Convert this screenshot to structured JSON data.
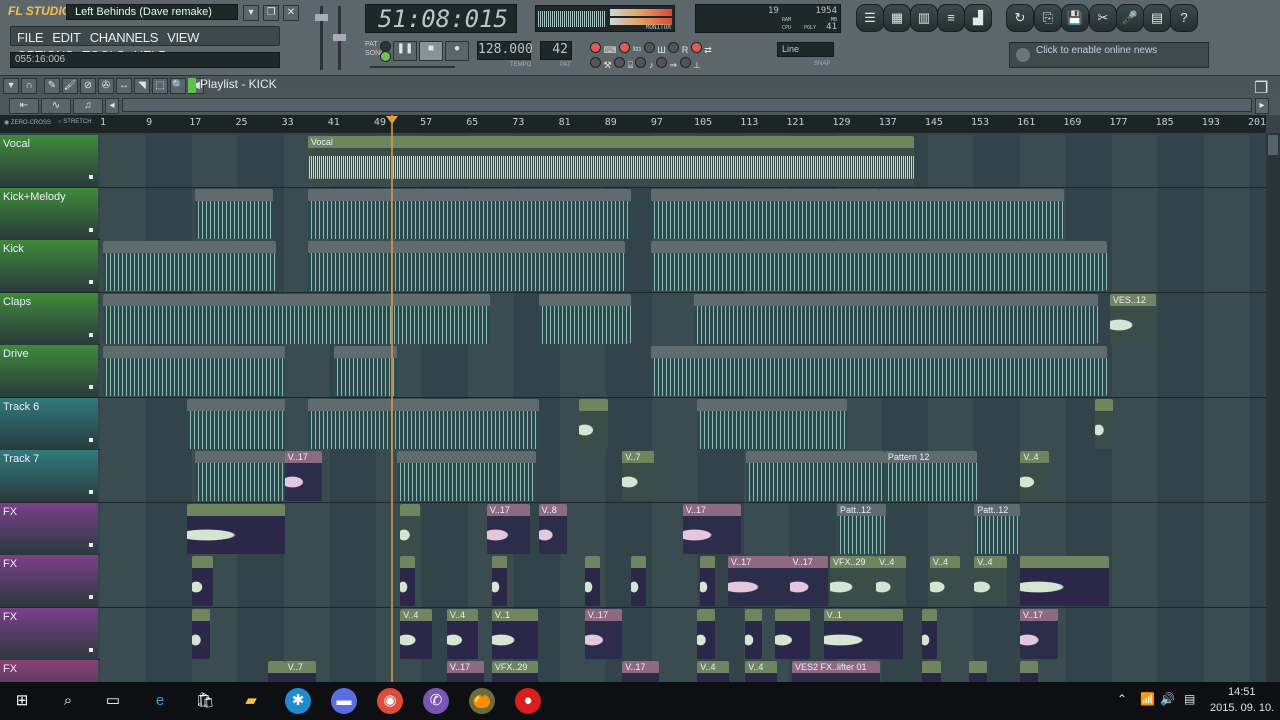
{
  "app": {
    "logo": "FL STUDIO",
    "project_title": "Left Behinds (Dave remake)",
    "menu": [
      "FILE",
      "EDIT",
      "CHANNELS",
      "VIEW",
      "OPTIONS",
      "TOOLS",
      "HELP"
    ],
    "hint_bar": "055:16:006"
  },
  "transport": {
    "time": "51:08:015",
    "tempo": "128.000",
    "tempo_label": "TEMPO",
    "pattern": "42",
    "pattern_label": "PAT",
    "pat_label": "PAT",
    "song_label": "SONG",
    "mode": "song",
    "monitor_label": "MONITOR"
  },
  "perf": {
    "polyphony": "19",
    "ram_mb": "1954",
    "ram_label": "RAM",
    "mb_label": "MB",
    "cpu_label": "CPU",
    "poly_label": "POLY",
    "poly_value": "41"
  },
  "snap": {
    "value": "Line",
    "label": "SNAP"
  },
  "news": {
    "text": "Click to enable online news"
  },
  "playlist": {
    "title": "Playlist - KICK",
    "zero_cross": "ZERO-CROSS",
    "stretch": "STRETCH",
    "ruler": [
      "1",
      "9",
      "17",
      "25",
      "33",
      "41",
      "49",
      "57",
      "65",
      "73",
      "81",
      "89",
      "97",
      "105",
      "113",
      "121",
      "129",
      "137",
      "145",
      "153",
      "161",
      "169",
      "177",
      "185",
      "193",
      "201"
    ],
    "playhead_bar": 50.9,
    "tracks": [
      {
        "name": "Vocal",
        "color": "#3f8a3a",
        "clips": [
          {
            "label": "Vocal",
            "start": 36.5,
            "len": 105,
            "kind": "audio"
          }
        ]
      },
      {
        "name": "Kick+Melody",
        "color": "#3f8a3a",
        "clips": [
          {
            "label": "",
            "start": 17,
            "len": 13.5,
            "kind": "pat"
          },
          {
            "label": "",
            "start": 36.5,
            "len": 56,
            "kind": "pat"
          },
          {
            "label": "",
            "start": 96,
            "len": 39.5,
            "kind": "pat"
          },
          {
            "label": "",
            "start": 135.5,
            "len": 32,
            "kind": "pat"
          }
        ]
      },
      {
        "name": "Kick",
        "color": "#3f8a3a",
        "clips": [
          {
            "label": "",
            "start": 1,
            "len": 30,
            "kind": "pat"
          },
          {
            "label": "",
            "start": 36.5,
            "len": 55,
            "kind": "pat"
          },
          {
            "label": "",
            "start": 96,
            "len": 79,
            "kind": "pat"
          }
        ]
      },
      {
        "name": "Claps",
        "color": "#3f8a3a",
        "clips": [
          {
            "label": "",
            "start": 1,
            "len": 67,
            "kind": "pat"
          },
          {
            "label": "",
            "start": 76.5,
            "len": 16,
            "kind": "pat"
          },
          {
            "label": "",
            "start": 103.5,
            "len": 70,
            "kind": "pat"
          },
          {
            "label": "VES..12",
            "start": 175.5,
            "len": 8,
            "kind": "audio"
          }
        ]
      },
      {
        "name": "Drive",
        "color": "#3f8a3a",
        "clips": [
          {
            "label": "",
            "start": 1,
            "len": 31.5,
            "kind": "pat"
          },
          {
            "label": "",
            "start": 41,
            "len": 11,
            "kind": "pat"
          },
          {
            "label": "",
            "start": 96,
            "len": 79,
            "kind": "pat"
          }
        ]
      },
      {
        "name": "Track 6",
        "color": "#2f7a7e",
        "clips": [
          {
            "label": "",
            "start": 15.5,
            "len": 17,
            "kind": "pat"
          },
          {
            "label": "",
            "start": 36.5,
            "len": 40,
            "kind": "pat"
          },
          {
            "label": "",
            "start": 83.5,
            "len": 5,
            "kind": "audio"
          },
          {
            "label": "",
            "start": 104,
            "len": 26,
            "kind": "pat"
          },
          {
            "label": "",
            "start": 173,
            "len": 3,
            "kind": "audio"
          }
        ]
      },
      {
        "name": "Track 7",
        "color": "#2f7a7e",
        "clips": [
          {
            "label": "",
            "start": 17,
            "len": 15.5,
            "kind": "pat"
          },
          {
            "label": "V..17",
            "start": 32.5,
            "len": 6.5,
            "kind": "pink"
          },
          {
            "label": "",
            "start": 52,
            "len": 24,
            "kind": "pat"
          },
          {
            "label": "V..7",
            "start": 91,
            "len": 5.5,
            "kind": "audio"
          },
          {
            "label": "",
            "start": 112.5,
            "len": 24,
            "kind": "pat"
          },
          {
            "label": "Pattern 12",
            "start": 136.5,
            "len": 16,
            "kind": "pat"
          },
          {
            "label": "V..4",
            "start": 160,
            "len": 5,
            "kind": "audio"
          }
        ]
      },
      {
        "name": "FX",
        "color": "#7a3f8a",
        "clips": [
          {
            "label": "",
            "start": 15.5,
            "len": 17,
            "kind": "purple"
          },
          {
            "label": "",
            "start": 52.5,
            "len": 3.5,
            "kind": "audio"
          },
          {
            "label": "V..17",
            "start": 67.5,
            "len": 7.5,
            "kind": "pink"
          },
          {
            "label": "V..8",
            "start": 76.5,
            "len": 5,
            "kind": "pink"
          },
          {
            "label": "V..17",
            "start": 101.5,
            "len": 10,
            "kind": "pink"
          },
          {
            "label": "Patt..12",
            "start": 128.2,
            "len": 8.5,
            "kind": "pat"
          },
          {
            "label": "Patt..12",
            "start": 152,
            "len": 8,
            "kind": "pat"
          }
        ]
      },
      {
        "name": "FX",
        "color": "#7a3f8a",
        "clips": [
          {
            "label": "",
            "start": 16.5,
            "len": 3.5,
            "kind": "purple"
          },
          {
            "label": "",
            "start": 52.5,
            "len": 2.6,
            "kind": "purple"
          },
          {
            "label": "",
            "start": 68.5,
            "len": 2.6,
            "kind": "purple"
          },
          {
            "label": "",
            "start": 84.5,
            "len": 2.6,
            "kind": "purple"
          },
          {
            "label": "",
            "start": 92.5,
            "len": 2.6,
            "kind": "purple"
          },
          {
            "label": "",
            "start": 104.5,
            "len": 2.6,
            "kind": "purple"
          },
          {
            "label": "V..17",
            "start": 109.3,
            "len": 10.7,
            "kind": "pink"
          },
          {
            "label": "V..17",
            "start": 120,
            "len": 6.6,
            "kind": "pink"
          },
          {
            "label": "VFX..29",
            "start": 127,
            "len": 8,
            "kind": "audio"
          },
          {
            "label": "V..4",
            "start": 135,
            "len": 5.2,
            "kind": "audio"
          },
          {
            "label": "V..4",
            "start": 144.3,
            "len": 5.2,
            "kind": "audio"
          },
          {
            "label": "V..4",
            "start": 152,
            "len": 5.7,
            "kind": "audio"
          },
          {
            "label": "",
            "start": 159.9,
            "len": 15.5,
            "kind": "purple"
          }
        ]
      },
      {
        "name": "FX",
        "color": "#7a3f8a",
        "clips": [
          {
            "label": "",
            "start": 16.5,
            "len": 3,
            "kind": "purple"
          },
          {
            "label": "V..4",
            "start": 52.5,
            "len": 5.5,
            "kind": "purple"
          },
          {
            "label": "V..4",
            "start": 60.6,
            "len": 5.4,
            "kind": "purple"
          },
          {
            "label": "V..1",
            "start": 68.4,
            "len": 8,
            "kind": "purple"
          },
          {
            "label": "V..17",
            "start": 84.5,
            "len": 6.4,
            "kind": "pink"
          },
          {
            "label": "",
            "start": 104,
            "len": 3,
            "kind": "purple"
          },
          {
            "label": "",
            "start": 112.3,
            "len": 3,
            "kind": "purple"
          },
          {
            "label": "",
            "start": 117.5,
            "len": 6,
            "kind": "purple"
          },
          {
            "label": "V..1",
            "start": 125.9,
            "len": 13.7,
            "kind": "purple"
          },
          {
            "label": "",
            "start": 143,
            "len": 2.6,
            "kind": "purple"
          },
          {
            "label": "V..17",
            "start": 159.9,
            "len": 6.6,
            "kind": "pink"
          }
        ]
      },
      {
        "name": "FX",
        "color": "#8a3f7a",
        "clips": [
          {
            "label": "",
            "start": 29.6,
            "len": 3,
            "kind": "purple"
          },
          {
            "label": "V..7",
            "start": 32.5,
            "len": 5.5,
            "kind": "purple"
          },
          {
            "label": "V..17",
            "start": 60.6,
            "len": 6.4,
            "kind": "pink"
          },
          {
            "label": "VFX..29",
            "start": 68.4,
            "len": 8,
            "kind": "purple"
          },
          {
            "label": "V..17",
            "start": 91,
            "len": 6.4,
            "kind": "pink"
          },
          {
            "label": "V..4",
            "start": 104,
            "len": 5.5,
            "kind": "purple"
          },
          {
            "label": "V..4",
            "start": 112.3,
            "len": 5.5,
            "kind": "purple"
          },
          {
            "label": "VES2 FX..lifter 01",
            "start": 120.4,
            "len": 15.3,
            "kind": "pink"
          },
          {
            "label": "",
            "start": 143,
            "len": 3.3,
            "kind": "purple"
          },
          {
            "label": "",
            "start": 151.1,
            "len": 3.1,
            "kind": "purple"
          },
          {
            "label": "",
            "start": 159.9,
            "len": 3.1,
            "kind": "purple"
          }
        ]
      }
    ]
  },
  "clip_colors": {
    "audio": [
      "#6f8560",
      "#3b4d48"
    ],
    "pat": [
      "#5f6b6c",
      "#2b4a4c"
    ],
    "pink": [
      "#8d6a80",
      "#2c2d4a"
    ],
    "purple": [
      "#6e8560",
      "#2a2748"
    ]
  },
  "taskbar": {
    "time": "14:51",
    "date": "2015. 09. 10."
  }
}
